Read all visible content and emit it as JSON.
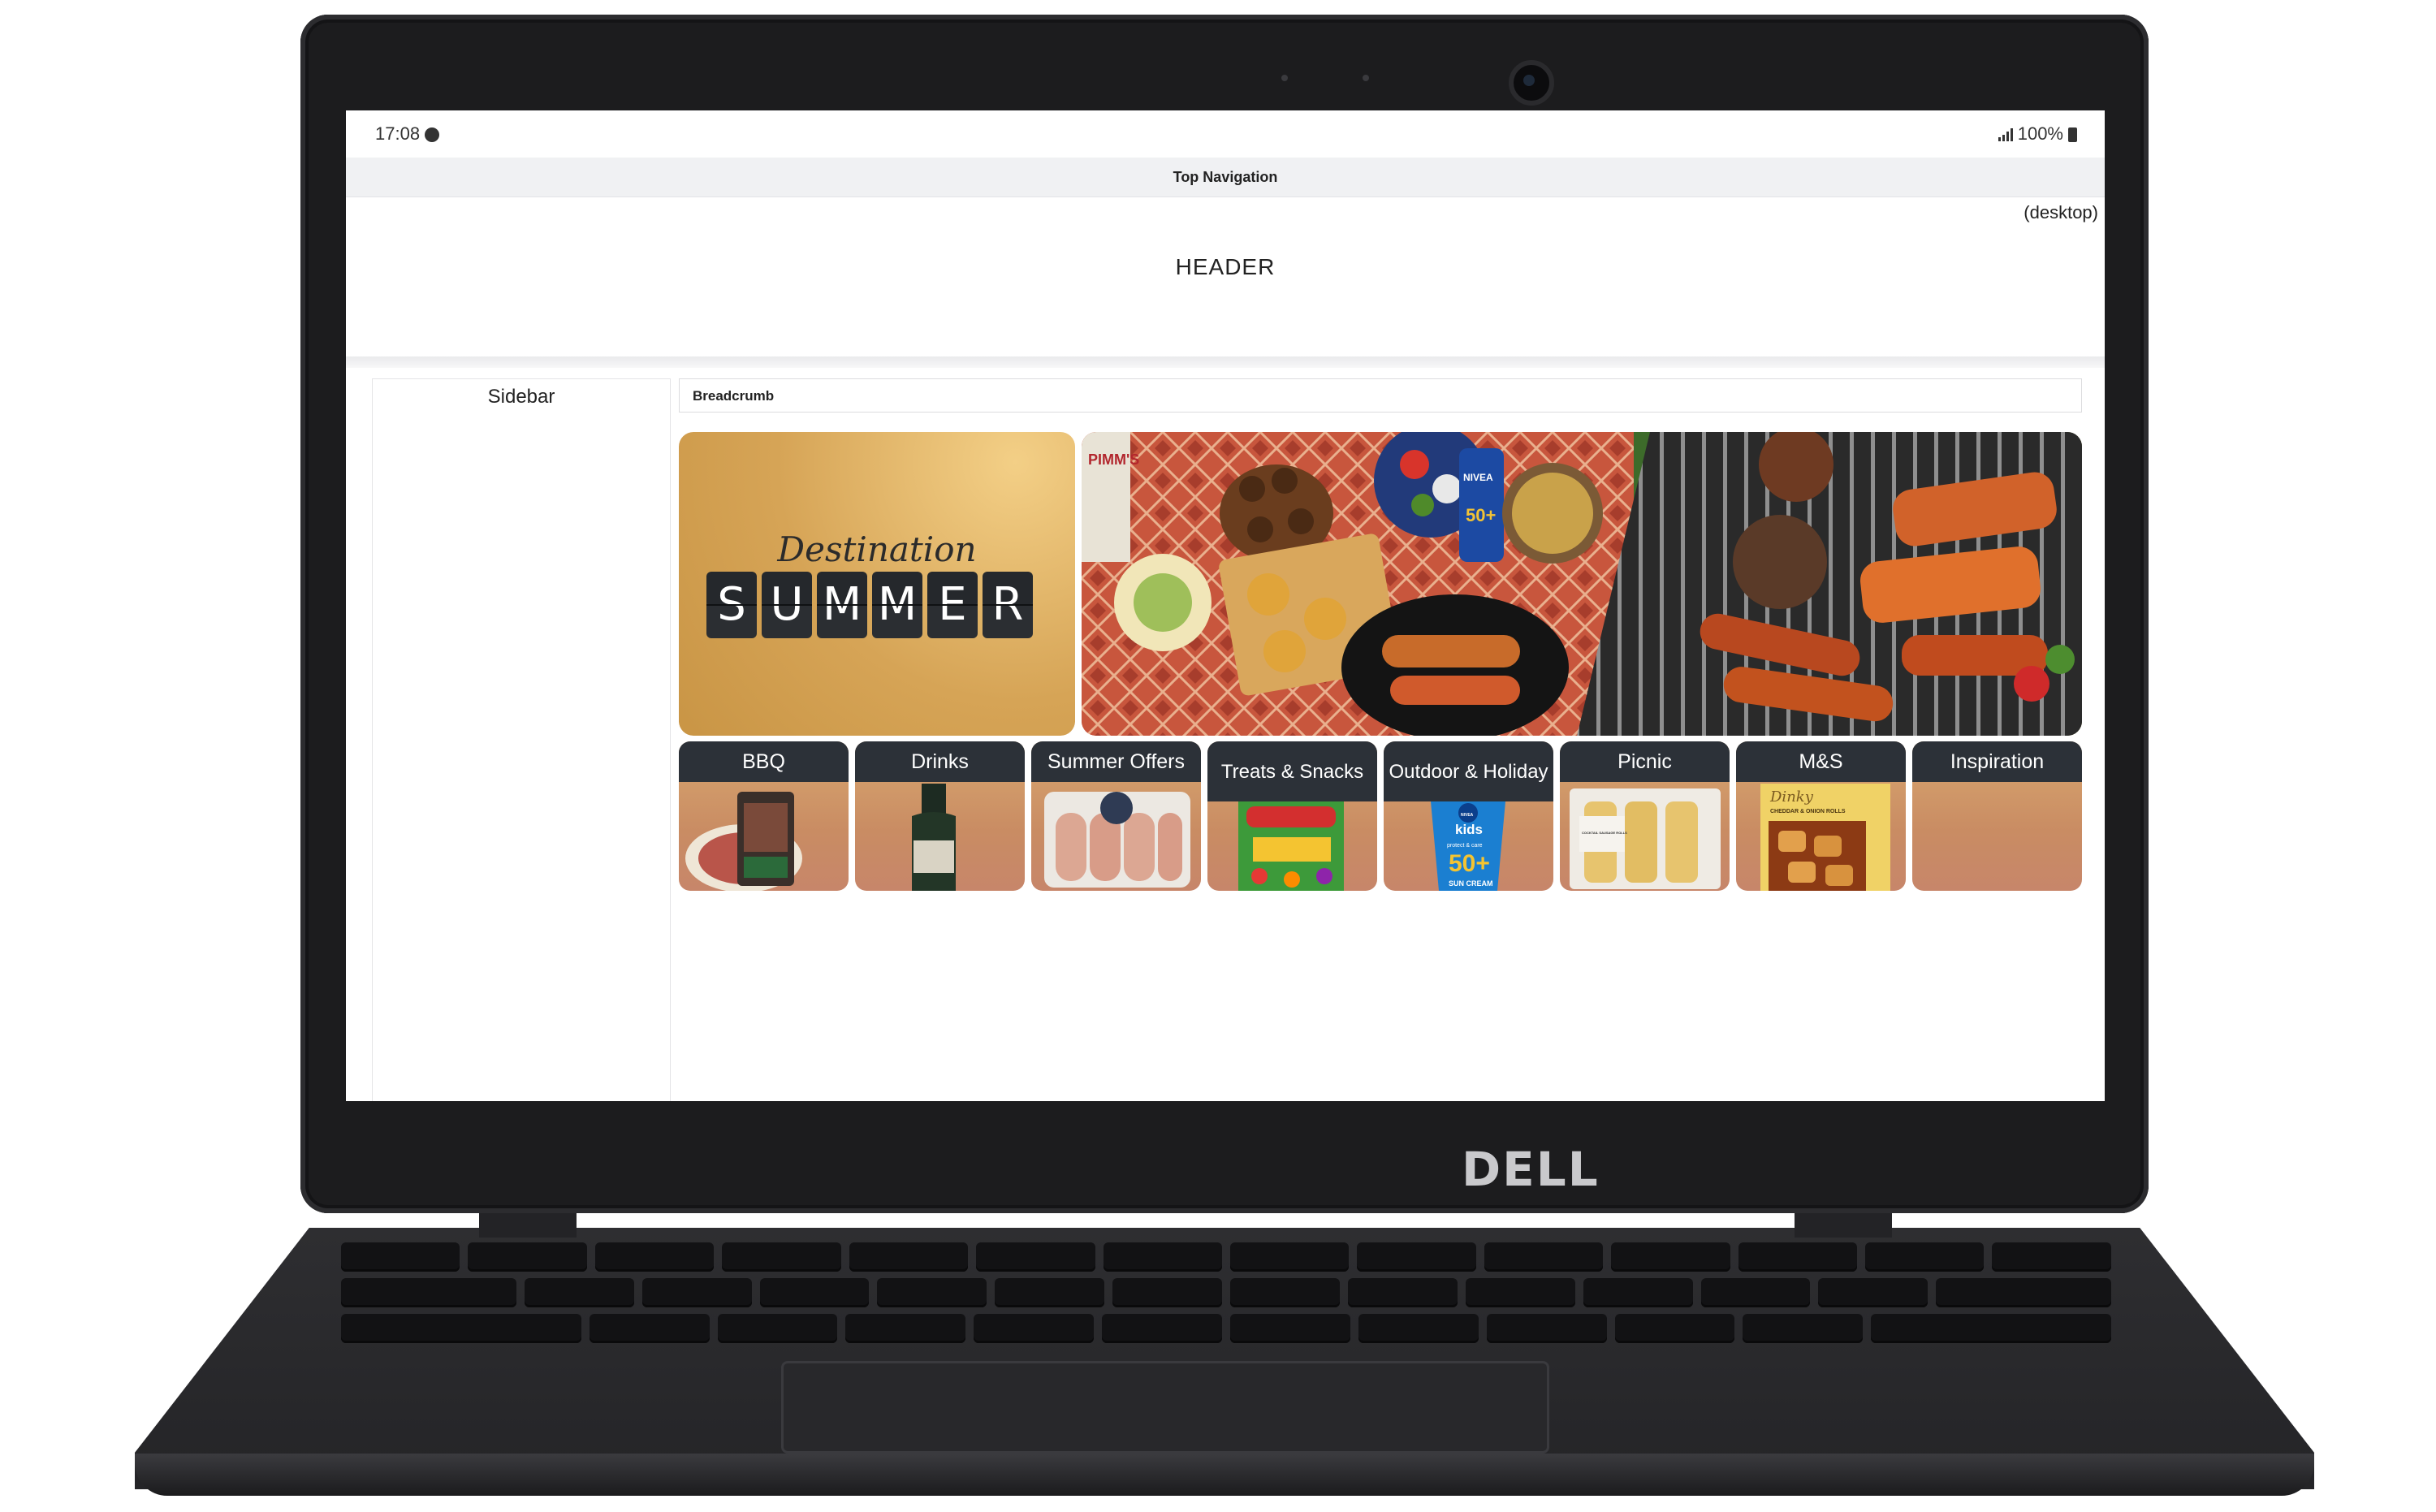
{
  "device": {
    "brand": "DELL"
  },
  "status_bar": {
    "time": "17:08",
    "battery": "100%"
  },
  "top_nav": {
    "label": "Top Navigation"
  },
  "header": {
    "title": "HEADER",
    "viewport_note": "(desktop)"
  },
  "sidebar": {
    "title": "Sidebar"
  },
  "breadcrumb": {
    "label": "Breadcrumb"
  },
  "hero": {
    "script_text": "Destination",
    "letters": [
      "S",
      "U",
      "M",
      "M",
      "E",
      "R"
    ],
    "image_text": [
      "PIMM'S",
      "NIVEA",
      "50+"
    ]
  },
  "categories": [
    {
      "label": "BBQ",
      "image": "bbq-product"
    },
    {
      "label": "Drinks",
      "image": "prosecco-bottle"
    },
    {
      "label": "Summer Offers",
      "image": "sausages-pack"
    },
    {
      "label": "Treats & Snacks",
      "image": "fruit-pastilles"
    },
    {
      "label": "Outdoor & Holiday",
      "image": "kids-sun-cream",
      "image_text": [
        "NIVEA",
        "kids",
        "protect & care",
        "50+",
        "SUN CREAM"
      ]
    },
    {
      "label": "Picnic",
      "image": "sausage-rolls",
      "image_text": [
        "COCKTAIL SAUSAGE ROLLS"
      ]
    },
    {
      "label": "M&S",
      "image": "cheddar-onion-rolls",
      "image_text": [
        "Dinky",
        "CHEDDAR & ONION ROLLS"
      ]
    },
    {
      "label": "Inspiration",
      "image": "none"
    }
  ],
  "colors": {
    "tile_bg": "#2c3138",
    "promo_gold": "#d6a456",
    "bezel": "#1c1c1e"
  }
}
